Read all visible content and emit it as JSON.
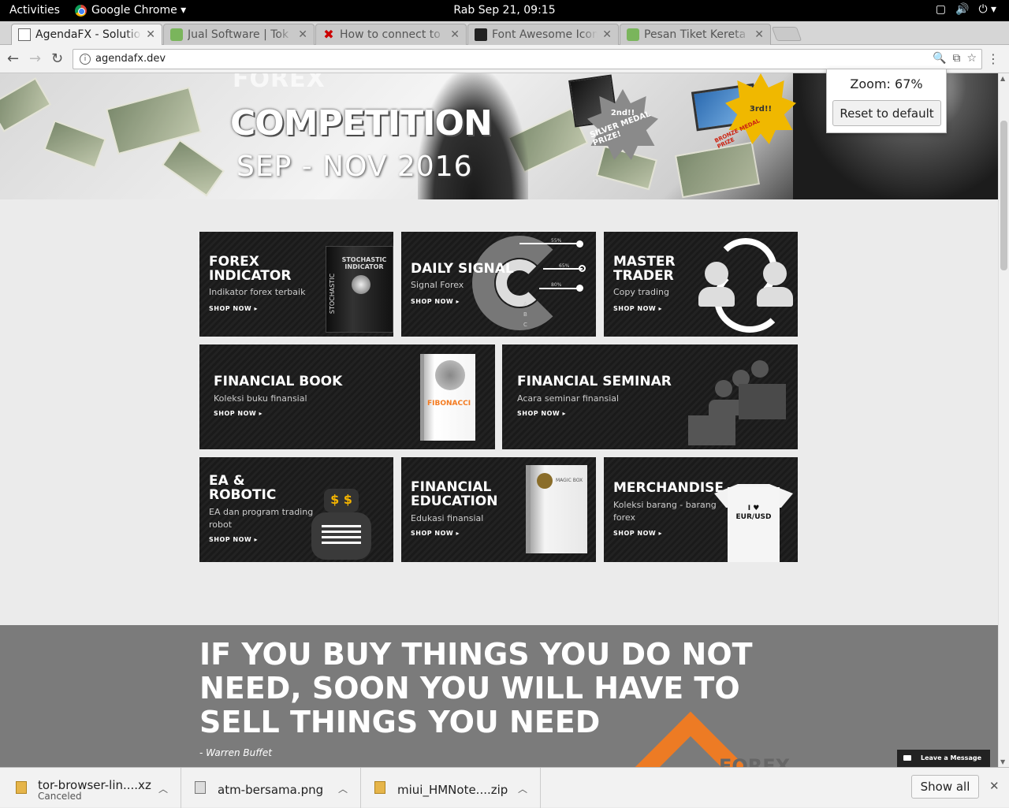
{
  "topbar": {
    "activities": "Activities",
    "app": "Google Chrome ▾",
    "clock": "Rab Sep 21, 09:15"
  },
  "tabs": [
    {
      "title": "AgendaFX - Solution",
      "icon": "page-icon"
    },
    {
      "title": "Jual Software | Tok",
      "icon": "tokopedia-icon"
    },
    {
      "title": "How to connect to",
      "icon": "x-icon"
    },
    {
      "title": "Font Awesome Icon",
      "icon": "flag-icon"
    },
    {
      "title": "Pesan Tiket Kereta",
      "icon": "tokopedia-icon"
    }
  ],
  "omnibox": {
    "url": "agendafx.dev"
  },
  "zoom": {
    "label": "Zoom: 67%",
    "reset": "Reset to default"
  },
  "banner": {
    "line1": "FOREX",
    "line2": "COMPETITION",
    "line3": "SEP - NOV 2016",
    "prize2": "2nd!!",
    "silver": "SILVER MEDAL PRIZE!",
    "prize3": "3rd!!",
    "bronze": "BRONZE MEDAL PRIZE"
  },
  "tiles": [
    {
      "title": "FOREX\nINDICATOR",
      "sub": "Indikator forex terbaik",
      "shop": "SHOP NOW ▸"
    },
    {
      "title": "DAILY SIGNAL",
      "sub": "Signal Forex",
      "shop": "SHOP NOW ▸"
    },
    {
      "title": "MASTER\nTRADER",
      "sub": "Copy trading",
      "shop": "SHOP NOW ▸"
    },
    {
      "title": "FINANCIAL BOOK",
      "sub": "Koleksi buku finansial",
      "shop": "SHOP NOW ▸"
    },
    {
      "title": "FINANCIAL SEMINAR",
      "sub": "Acara seminar finansial",
      "shop": "SHOP NOW ▸"
    },
    {
      "title": "EA &\nROBOTIC",
      "sub": "EA dan program trading\nrobot",
      "shop": "SHOP NOW ▸"
    },
    {
      "title": "FINANCIAL\nEDUCATION",
      "sub": "Edukasi finansial",
      "shop": "SHOP NOW ▸"
    },
    {
      "title": "MERCHANDISE",
      "sub": "Koleksi barang - barang\nforex",
      "shop": "SHOP NOW ▸"
    }
  ],
  "art": {
    "stochastic": "STOCHASTIC",
    "stoch_box": "STOCHASTIC INDICATOR",
    "fibonacci": "FIBONACCI",
    "magicbox": "MAGIC BOX",
    "tshirt": "I ♥\nEUR/USD",
    "signal_pcts": [
      "55%",
      "65%",
      "80%"
    ],
    "signal_letters": [
      "A",
      "B",
      "C"
    ]
  },
  "quote": {
    "text": "IF YOU BUY THINGS YOU DO NOT NEED, SOON YOU WILL HAVE TO SELL THINGS YOU NEED",
    "author": "- Warren Buffet",
    "logo_text": "FOREX"
  },
  "chat": {
    "label": "Leave a Message"
  },
  "downloads": [
    {
      "name": "tor-browser-lin....xz",
      "status": "Canceled"
    },
    {
      "name": "atm-bersama.png",
      "status": ""
    },
    {
      "name": "miui_HMNote....zip",
      "status": ""
    }
  ],
  "download_bar": {
    "show_all": "Show all"
  }
}
